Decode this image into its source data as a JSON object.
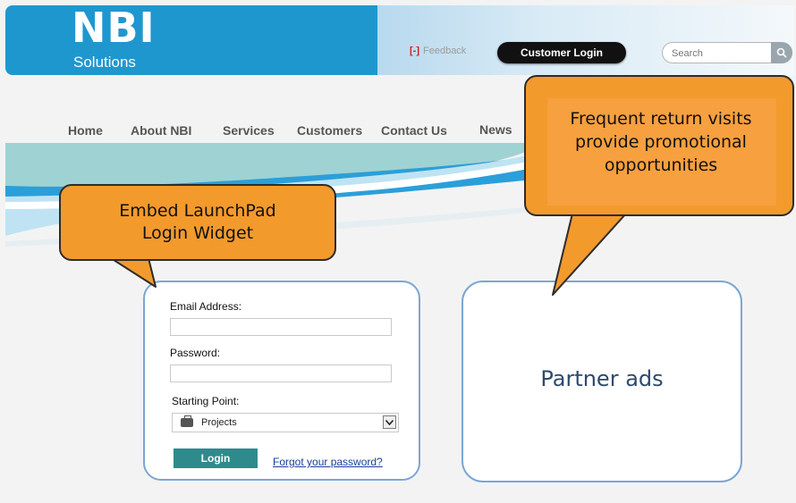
{
  "header": {
    "logo_main": "NBI",
    "logo_sub": "Solutions",
    "feedback_label": "Feedback",
    "customer_login_label": "Customer Login",
    "search_placeholder": "Search"
  },
  "nav": {
    "items": [
      "Home",
      "About NBI",
      "Services",
      "Customers",
      "Contact Us",
      "News"
    ]
  },
  "login_widget": {
    "email_label": "Email Address:",
    "email_value": "",
    "password_label": "Password:",
    "password_value": "",
    "starting_point_label": "Starting Point:",
    "starting_point_value": "Projects",
    "login_button": "Login",
    "forgot_link": "Forgot your password?"
  },
  "partner": {
    "text": "Partner ads"
  },
  "callouts": {
    "left": [
      "Embed LaunchPad",
      "Login Widget"
    ],
    "right": [
      "Frequent return visits",
      "provide promotional",
      "opportunities"
    ]
  },
  "colors": {
    "header_blue": "#1e97cf",
    "callout_orange": "#f39a2d",
    "login_button": "#2f8a8c",
    "box_border": "#7aa6d6"
  }
}
